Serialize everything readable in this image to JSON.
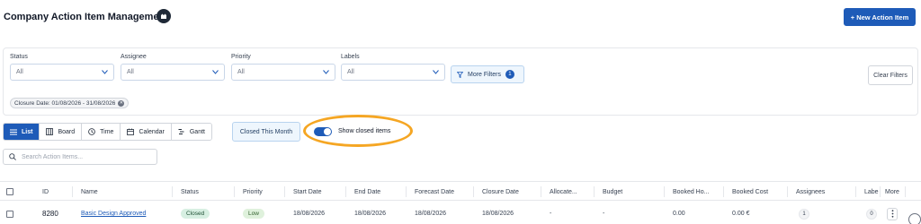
{
  "header": {
    "title": "Company Action Item Management",
    "new_button": "+ New Action Item",
    "accent": "#1e5bb8"
  },
  "filters": {
    "status": {
      "label": "Status",
      "value": "All"
    },
    "assignee": {
      "label": "Assignee",
      "value": "All"
    },
    "priority": {
      "label": "Priority",
      "value": "All"
    },
    "labels": {
      "label": "Labels",
      "value": "All"
    },
    "more_filters": {
      "label": "More Filters",
      "count": "1"
    },
    "clear": "Clear Filters",
    "active_chip": "Closure Date: 01/08/2026 - 31/08/2026"
  },
  "views": {
    "tabs": [
      {
        "label": "List",
        "icon": "list-icon",
        "active": true
      },
      {
        "label": "Board",
        "icon": "board-icon",
        "active": false
      },
      {
        "label": "Time",
        "icon": "clock-icon",
        "active": false
      },
      {
        "label": "Calendar",
        "icon": "calendar-icon",
        "active": false
      },
      {
        "label": "Gantt",
        "icon": "gantt-icon",
        "active": false
      }
    ],
    "closed_this_month": "Closed This Month",
    "show_closed": {
      "label": "Show closed items",
      "enabled": true
    }
  },
  "search": {
    "placeholder": "Search Action Items..."
  },
  "table": {
    "columns": [
      "ID",
      "Name",
      "Status",
      "Priority",
      "Start Date",
      "End Date",
      "Forecast Date",
      "Closure Date",
      "Allocate...",
      "Budget",
      "Booked Ho...",
      "Booked Cost",
      "Assignees",
      "Labe",
      "More"
    ],
    "rows": [
      {
        "id": "8280",
        "name": "Basic Design Approved",
        "status": "Closed",
        "priority": "Low",
        "start_date": "18/08/2026",
        "end_date": "18/08/2026",
        "forecast_date": "18/08/2026",
        "closure_date": "18/08/2026",
        "allocated": "-",
        "budget": "-",
        "booked_hours": "0.00",
        "booked_cost": "0.00 €",
        "assignees": "1",
        "labels": "0"
      }
    ]
  }
}
